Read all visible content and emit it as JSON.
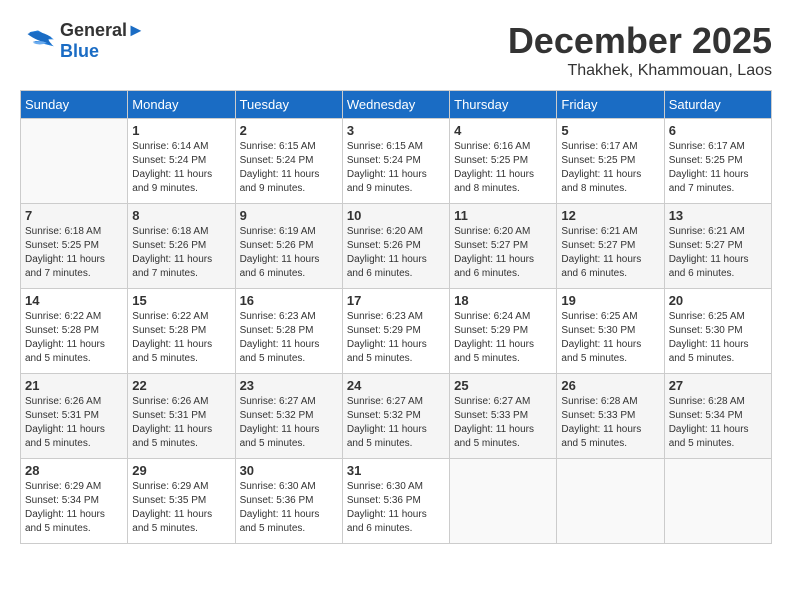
{
  "header": {
    "logo_line1": "General",
    "logo_line2": "Blue",
    "month": "December 2025",
    "location": "Thakhek, Khammouan, Laos"
  },
  "days_of_week": [
    "Sunday",
    "Monday",
    "Tuesday",
    "Wednesday",
    "Thursday",
    "Friday",
    "Saturday"
  ],
  "weeks": [
    [
      {
        "day": "",
        "info": ""
      },
      {
        "day": "1",
        "info": "Sunrise: 6:14 AM\nSunset: 5:24 PM\nDaylight: 11 hours\nand 9 minutes."
      },
      {
        "day": "2",
        "info": "Sunrise: 6:15 AM\nSunset: 5:24 PM\nDaylight: 11 hours\nand 9 minutes."
      },
      {
        "day": "3",
        "info": "Sunrise: 6:15 AM\nSunset: 5:24 PM\nDaylight: 11 hours\nand 9 minutes."
      },
      {
        "day": "4",
        "info": "Sunrise: 6:16 AM\nSunset: 5:25 PM\nDaylight: 11 hours\nand 8 minutes."
      },
      {
        "day": "5",
        "info": "Sunrise: 6:17 AM\nSunset: 5:25 PM\nDaylight: 11 hours\nand 8 minutes."
      },
      {
        "day": "6",
        "info": "Sunrise: 6:17 AM\nSunset: 5:25 PM\nDaylight: 11 hours\nand 7 minutes."
      }
    ],
    [
      {
        "day": "7",
        "info": "Sunrise: 6:18 AM\nSunset: 5:25 PM\nDaylight: 11 hours\nand 7 minutes."
      },
      {
        "day": "8",
        "info": "Sunrise: 6:18 AM\nSunset: 5:26 PM\nDaylight: 11 hours\nand 7 minutes."
      },
      {
        "day": "9",
        "info": "Sunrise: 6:19 AM\nSunset: 5:26 PM\nDaylight: 11 hours\nand 6 minutes."
      },
      {
        "day": "10",
        "info": "Sunrise: 6:20 AM\nSunset: 5:26 PM\nDaylight: 11 hours\nand 6 minutes."
      },
      {
        "day": "11",
        "info": "Sunrise: 6:20 AM\nSunset: 5:27 PM\nDaylight: 11 hours\nand 6 minutes."
      },
      {
        "day": "12",
        "info": "Sunrise: 6:21 AM\nSunset: 5:27 PM\nDaylight: 11 hours\nand 6 minutes."
      },
      {
        "day": "13",
        "info": "Sunrise: 6:21 AM\nSunset: 5:27 PM\nDaylight: 11 hours\nand 6 minutes."
      }
    ],
    [
      {
        "day": "14",
        "info": "Sunrise: 6:22 AM\nSunset: 5:28 PM\nDaylight: 11 hours\nand 5 minutes."
      },
      {
        "day": "15",
        "info": "Sunrise: 6:22 AM\nSunset: 5:28 PM\nDaylight: 11 hours\nand 5 minutes."
      },
      {
        "day": "16",
        "info": "Sunrise: 6:23 AM\nSunset: 5:28 PM\nDaylight: 11 hours\nand 5 minutes."
      },
      {
        "day": "17",
        "info": "Sunrise: 6:23 AM\nSunset: 5:29 PM\nDaylight: 11 hours\nand 5 minutes."
      },
      {
        "day": "18",
        "info": "Sunrise: 6:24 AM\nSunset: 5:29 PM\nDaylight: 11 hours\nand 5 minutes."
      },
      {
        "day": "19",
        "info": "Sunrise: 6:25 AM\nSunset: 5:30 PM\nDaylight: 11 hours\nand 5 minutes."
      },
      {
        "day": "20",
        "info": "Sunrise: 6:25 AM\nSunset: 5:30 PM\nDaylight: 11 hours\nand 5 minutes."
      }
    ],
    [
      {
        "day": "21",
        "info": "Sunrise: 6:26 AM\nSunset: 5:31 PM\nDaylight: 11 hours\nand 5 minutes."
      },
      {
        "day": "22",
        "info": "Sunrise: 6:26 AM\nSunset: 5:31 PM\nDaylight: 11 hours\nand 5 minutes."
      },
      {
        "day": "23",
        "info": "Sunrise: 6:27 AM\nSunset: 5:32 PM\nDaylight: 11 hours\nand 5 minutes."
      },
      {
        "day": "24",
        "info": "Sunrise: 6:27 AM\nSunset: 5:32 PM\nDaylight: 11 hours\nand 5 minutes."
      },
      {
        "day": "25",
        "info": "Sunrise: 6:27 AM\nSunset: 5:33 PM\nDaylight: 11 hours\nand 5 minutes."
      },
      {
        "day": "26",
        "info": "Sunrise: 6:28 AM\nSunset: 5:33 PM\nDaylight: 11 hours\nand 5 minutes."
      },
      {
        "day": "27",
        "info": "Sunrise: 6:28 AM\nSunset: 5:34 PM\nDaylight: 11 hours\nand 5 minutes."
      }
    ],
    [
      {
        "day": "28",
        "info": "Sunrise: 6:29 AM\nSunset: 5:34 PM\nDaylight: 11 hours\nand 5 minutes."
      },
      {
        "day": "29",
        "info": "Sunrise: 6:29 AM\nSunset: 5:35 PM\nDaylight: 11 hours\nand 5 minutes."
      },
      {
        "day": "30",
        "info": "Sunrise: 6:30 AM\nSunset: 5:36 PM\nDaylight: 11 hours\nand 5 minutes."
      },
      {
        "day": "31",
        "info": "Sunrise: 6:30 AM\nSunset: 5:36 PM\nDaylight: 11 hours\nand 6 minutes."
      },
      {
        "day": "",
        "info": ""
      },
      {
        "day": "",
        "info": ""
      },
      {
        "day": "",
        "info": ""
      }
    ]
  ]
}
